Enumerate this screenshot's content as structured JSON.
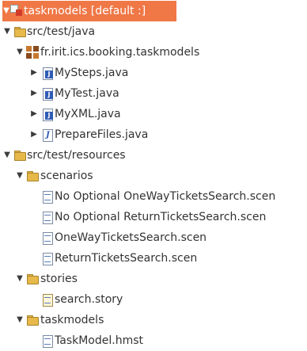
{
  "tree": {
    "project": {
      "label": "taskmodels [default :]",
      "icon": "project-icon"
    },
    "src_test_java": {
      "label": "src/test/java",
      "icon": "source-folder-icon"
    },
    "package": {
      "label": "fr.irit.ics.booking.taskmodels",
      "icon": "package-icon"
    },
    "java_files": [
      {
        "label": "MySteps.java",
        "icon": "java-class-icon"
      },
      {
        "label": "MyTest.java",
        "icon": "java-class-icon"
      },
      {
        "label": "MyXML.java",
        "icon": "java-class-icon"
      },
      {
        "label": "PrepareFiles.java",
        "icon": "java-file-icon"
      }
    ],
    "src_test_resources": {
      "label": "src/test/resources",
      "icon": "source-folder-icon"
    },
    "scenarios": {
      "label": "scenarios",
      "icon": "folder-icon",
      "files": [
        "No Optional OneWayTicketsSearch.scen",
        "No Optional ReturnTicketsSearch.scen",
        "OneWayTicketsSearch.scen",
        "ReturnTicketsSearch.scen"
      ]
    },
    "stories": {
      "label": "stories",
      "icon": "folder-icon",
      "files": [
        "search.story"
      ]
    },
    "taskmodels": {
      "label": "taskmodels",
      "icon": "folder-icon",
      "files": [
        "TaskModel.hmst"
      ]
    }
  },
  "arrows": {
    "expanded": "▼",
    "collapsed": "▶"
  },
  "colors": {
    "selection": "#f07746",
    "selection_text": "#ffffff",
    "text": "#333333"
  }
}
